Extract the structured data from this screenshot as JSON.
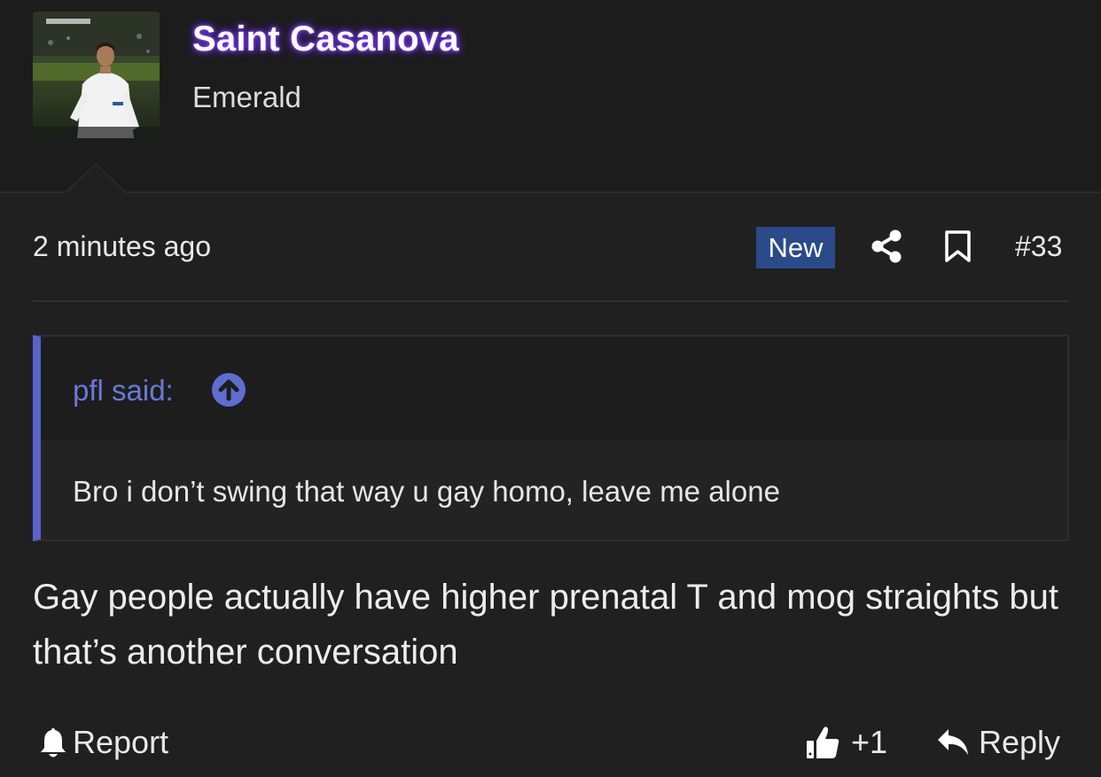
{
  "user": {
    "name": "Saint Casanova",
    "title": "Emerald",
    "name_glow_color": "#7b3fff"
  },
  "post": {
    "timestamp": "2 minutes ago",
    "badge": "New",
    "number": "#33",
    "body": "Gay people actually have higher prenatal T and mog straights but that’s another conversation"
  },
  "quote": {
    "author_label": "pfl said:",
    "text": "Bro i don’t swing that way u gay homo, leave me alone",
    "accent_color": "#5864c8"
  },
  "actions": {
    "report_label": "Report",
    "like_count": "+1",
    "reply_label": "Reply"
  },
  "icons": {
    "share": "share-icon",
    "bookmark": "bookmark-icon",
    "quote_jump": "arrow-up-circle-icon",
    "report": "bell-icon",
    "like": "thumbs-up-icon",
    "reply": "reply-arrow-icon"
  },
  "colors": {
    "background": "#202020",
    "header_background": "#1c1c1c",
    "badge_background": "#2b4a8a",
    "quote_link": "#6b79d6"
  }
}
